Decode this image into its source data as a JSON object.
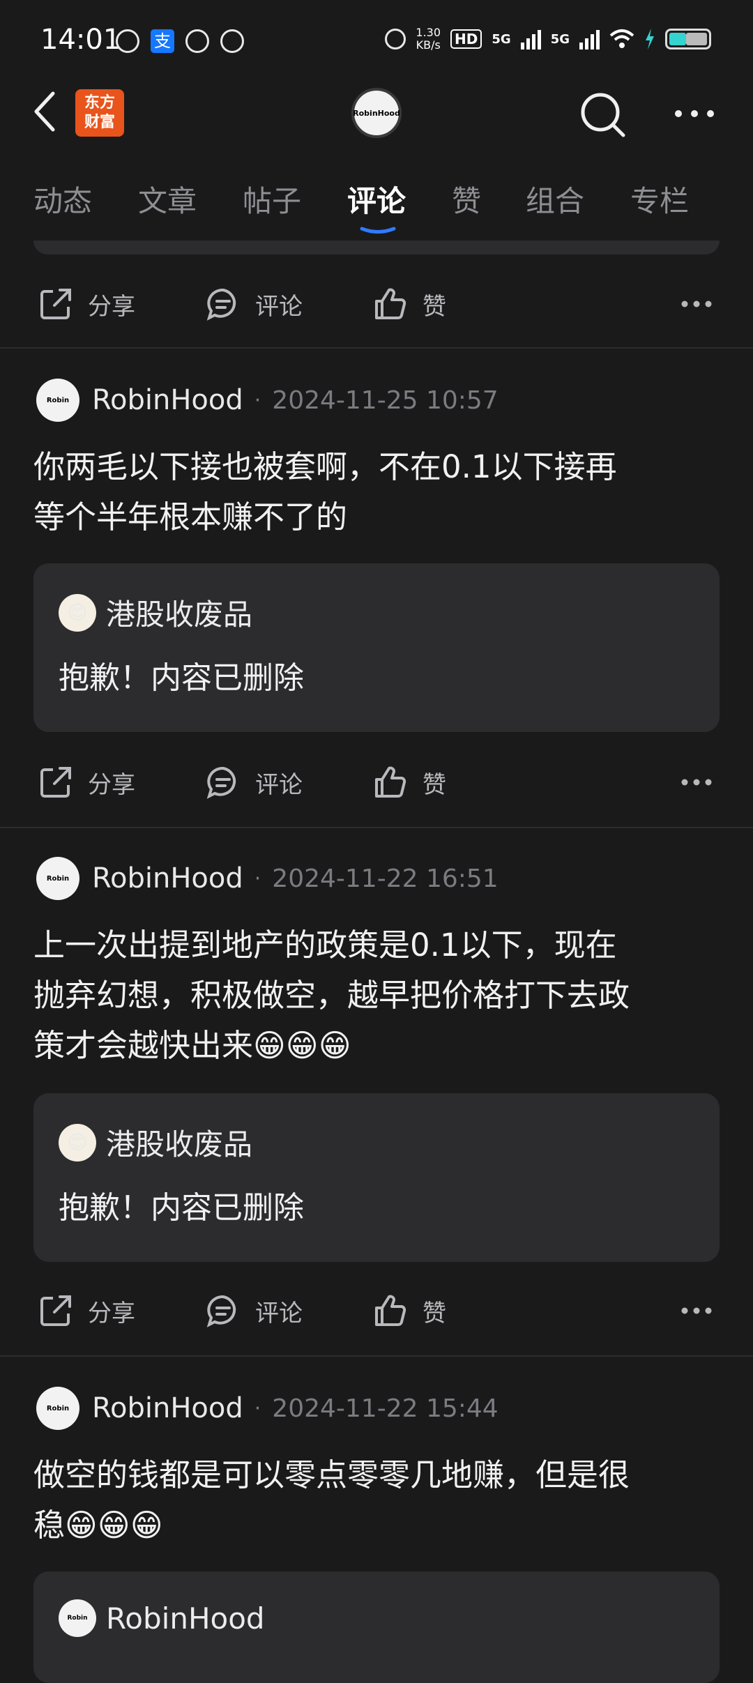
{
  "status_bar": {
    "time": "14:01",
    "speed_value": "1.30",
    "speed_unit": "KB/s",
    "hd_label": "HD",
    "net1": "5G",
    "net2": "5G",
    "alipay_glyph": "支"
  },
  "header": {
    "logo_line1": "东方",
    "logo_line2": "财富",
    "avatar_label": "RobinHood"
  },
  "tabs": [
    {
      "label": "动态"
    },
    {
      "label": "文章"
    },
    {
      "label": "帖子"
    },
    {
      "label": "评论"
    },
    {
      "label": "赞"
    },
    {
      "label": "组合"
    },
    {
      "label": "专栏"
    }
  ],
  "active_tab": "评论",
  "actions": {
    "share": "分享",
    "comment": "评论",
    "like": "赞"
  },
  "posts": [
    {
      "author": "RobinHood",
      "time": "2024-11-25 10:57",
      "text_line1": "你两毛以下接也被套啊，不在0.1以下接再",
      "text_line2": "等个半年根本赚不了的",
      "quote_author": "港股收废品",
      "quote_text": "抱歉！内容已删除"
    },
    {
      "author": "RobinHood",
      "time": "2024-11-22 16:51",
      "text_line1": "上一次出提到地产的政策是0.1以下，现在",
      "text_line2": "抛弃幻想，积极做空，越早把价格打下去政",
      "text_line3": "策才会越快出来😁😁😁",
      "quote_author": "港股收废品",
      "quote_text": "抱歉！内容已删除"
    },
    {
      "author": "RobinHood",
      "time": "2024-11-22 15:44",
      "text_line1": "做空的钱都是可以零点零零几地赚，但是很",
      "text_line2": "稳😁😁😁",
      "quote_author": "RobinHood"
    }
  ],
  "colors": {
    "accent": "#2f7bff",
    "logo": "#e8541b",
    "background": "#1a1a1b",
    "card": "#2c2c2e"
  }
}
